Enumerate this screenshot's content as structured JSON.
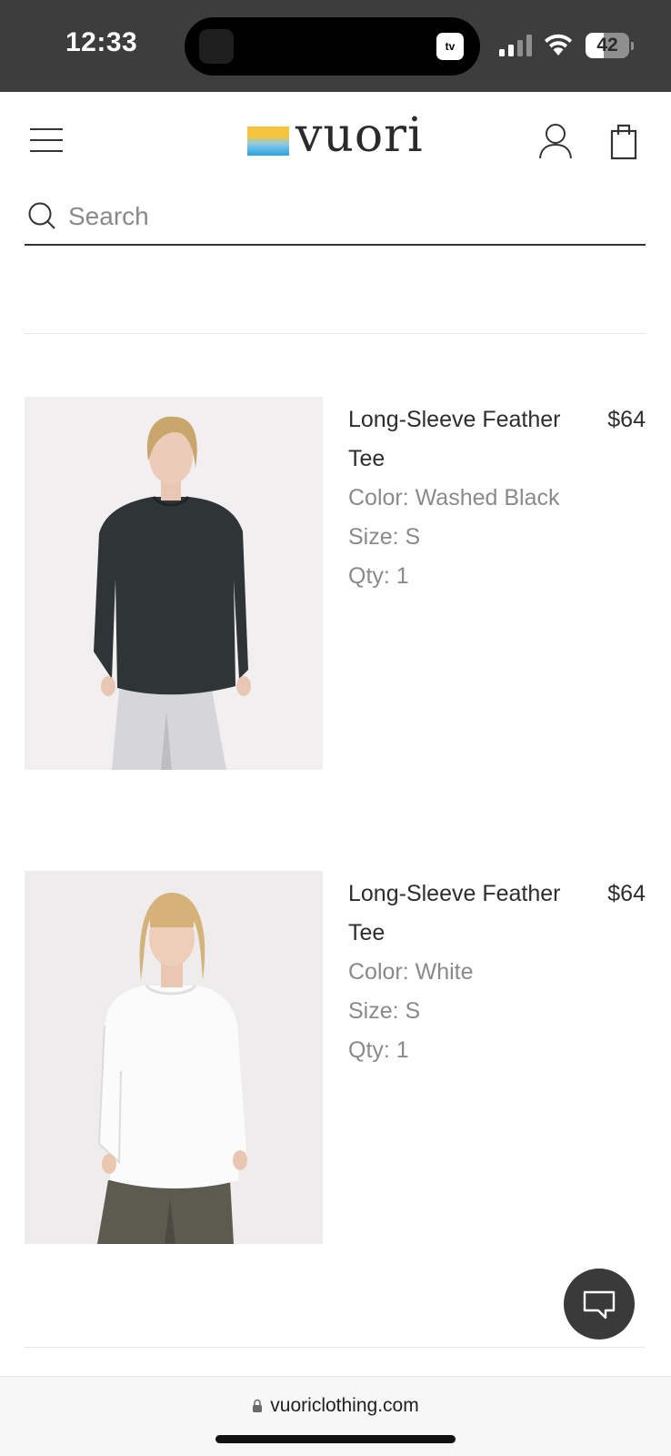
{
  "status_bar": {
    "time": "12:33",
    "battery_level": "42",
    "app_indicator": "tv"
  },
  "header": {
    "logo_text": "vuori",
    "brand_gradient": [
      "#f7c53d",
      "#8bc8e6",
      "#2aa3e0"
    ]
  },
  "search": {
    "placeholder": "Search",
    "value": ""
  },
  "products": [
    {
      "name": "Long-Sleeve Feather Tee",
      "price": "$64",
      "color": "Color: Washed Black",
      "size": "Size: S",
      "qty": "Qty: 1",
      "swatch": "#2f3436",
      "pants": "#d6d6da"
    },
    {
      "name": "Long-Sleeve Feather Tee",
      "price": "$64",
      "color": "Color: White",
      "size": "Size: S",
      "qty": "Qty: 1",
      "swatch": "#fbfbfb",
      "pants": "#5d5a50"
    }
  ],
  "browser": {
    "url": "vuoriclothing.com"
  },
  "icons": {
    "menu": "hamburger-menu-icon",
    "account": "user-icon",
    "cart": "shopping-bag-icon",
    "search": "search-icon",
    "chat": "chat-bubble-icon",
    "lock": "lock-icon"
  }
}
